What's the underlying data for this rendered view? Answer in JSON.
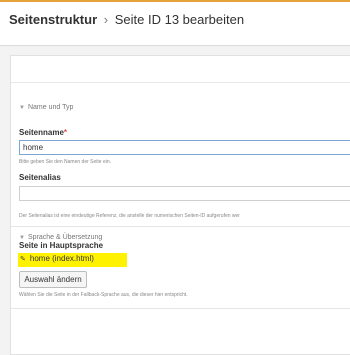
{
  "header": {
    "module": "Seitenstruktur",
    "separator": "›",
    "title": "Seite ID 13 bearbeiten"
  },
  "sections": {
    "name_type": {
      "caret_icon": "chevron-down-icon",
      "title": "Name und Typ",
      "page_name_label": "Seitenname",
      "required_mark": "*",
      "page_name_value": "home",
      "page_name_help": "Bitte geben Sie den Namen der Seite ein.",
      "alias_label": "Seitenalias",
      "alias_value": "",
      "alias_help": "Der Seitenalias ist eine eindeutige Referenz, die anstelle der numerischen Seiten-ID aufgerufen wer"
    },
    "language": {
      "caret_icon": "chevron-down-icon",
      "title": "Sprache & Übersetzung",
      "main_language_label": "Seite in Hauptsprache",
      "linked_page_icon": "pencil-icon",
      "linked_page": "home (index.html)",
      "select_button": "Auswahl ändern",
      "select_help": "Wählen Sie die Seite in der Fallback-Sprache aus, die dieser hier entspricht."
    }
  },
  "colors": {
    "accent": "#e8a23c",
    "highlight": "#fff200",
    "focus_border": "#7ba6d8"
  }
}
